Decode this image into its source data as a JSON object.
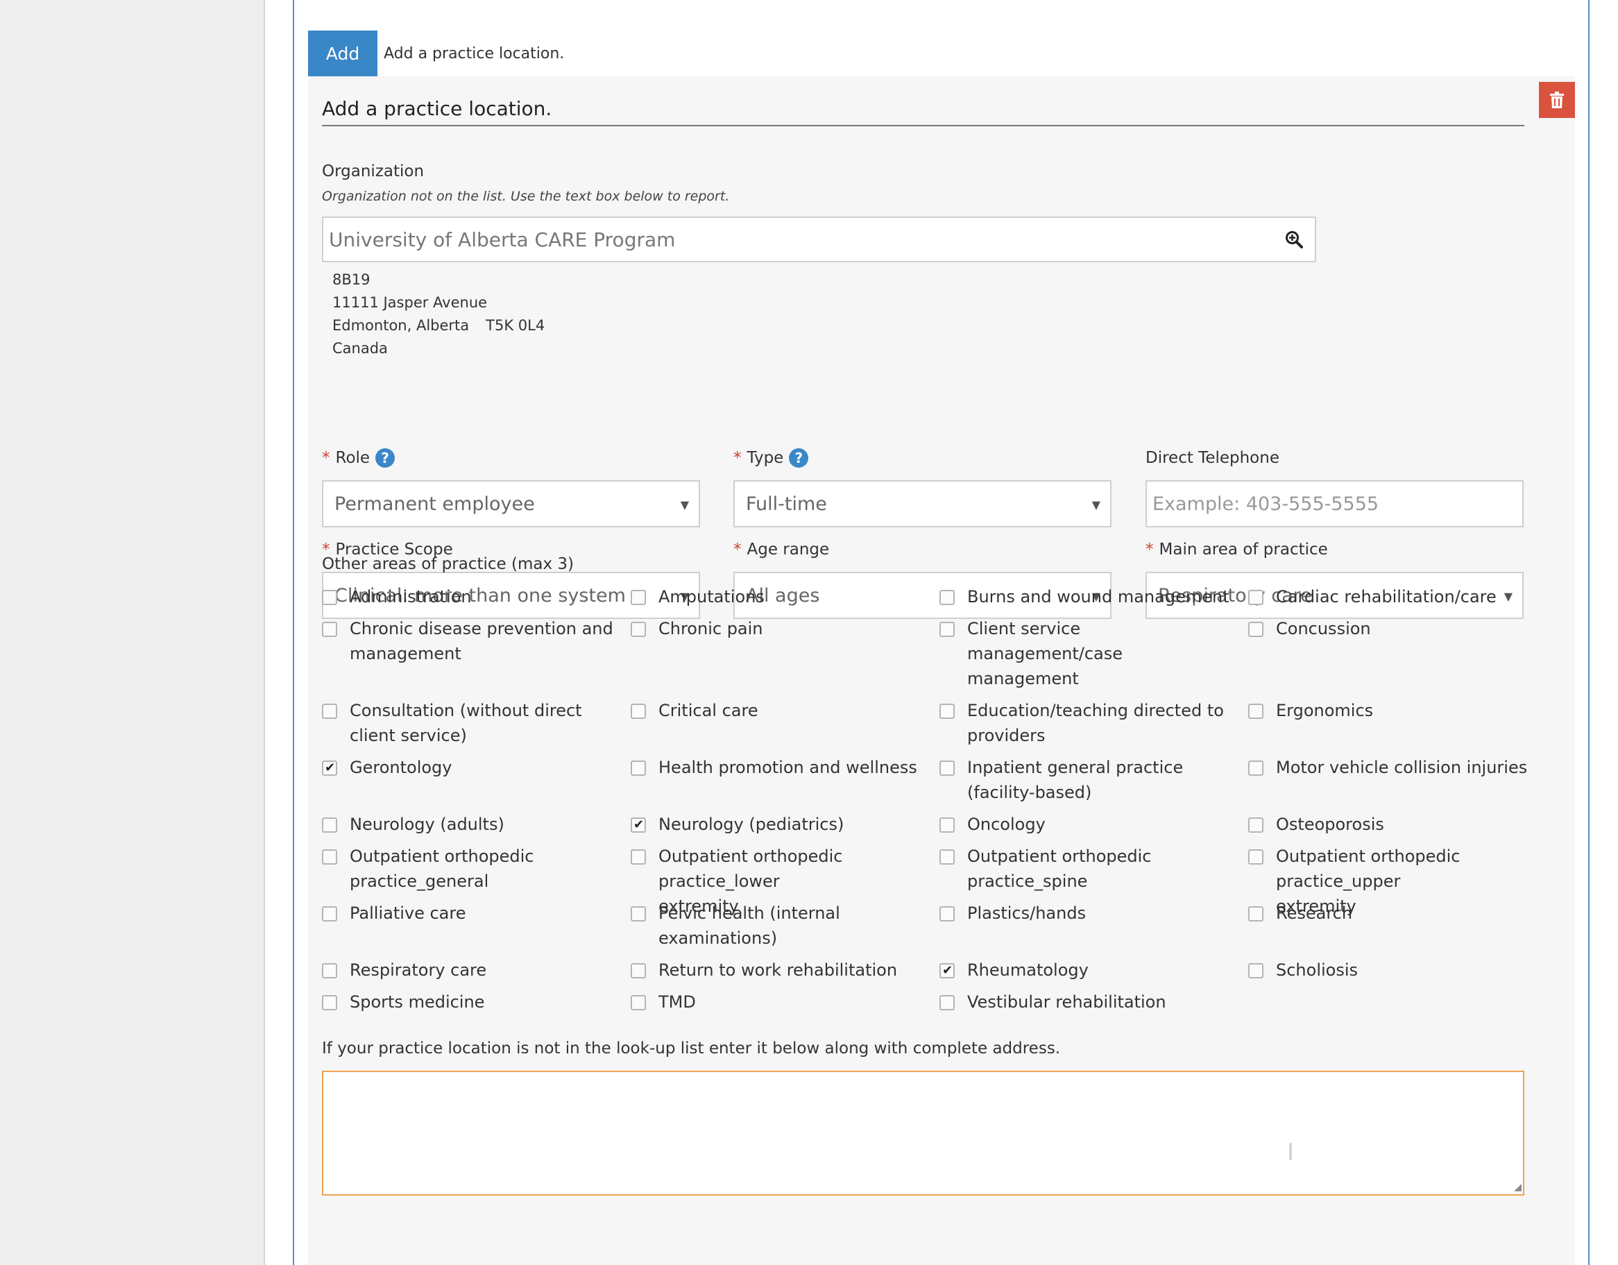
{
  "add_row": {
    "button_label": "Add",
    "hint": "Add a practice location."
  },
  "card": {
    "title": "Add a practice location.",
    "organization": {
      "label": "Organization",
      "note": "Organization not on the list. Use the text box below to report.",
      "value": "University of Alberta CARE Program",
      "address": {
        "line1": "8B19",
        "line2": "11111 Jasper Avenue",
        "city": "Edmonton, Alberta",
        "postal": "T5K 0L4",
        "country": "Canada"
      }
    },
    "fields": {
      "role": {
        "required_mark": "*",
        "label": "Role",
        "help": "?",
        "value": "Permanent employee"
      },
      "type": {
        "required_mark": "*",
        "label": "Type",
        "help": "?",
        "value": "Full-time"
      },
      "phone": {
        "label": "Direct Telephone",
        "placeholder": "Example: 403-555-5555"
      },
      "scope": {
        "required_mark": "*",
        "label": "Practice Scope",
        "value": "Clinical: more than one system"
      },
      "age": {
        "required_mark": "*",
        "label": "Age range",
        "value": "All ages"
      },
      "main_area": {
        "required_mark": "*",
        "label": "Main area of practice",
        "value": "Respiratory care"
      }
    },
    "other_areas": {
      "label": "Other areas of practice (max 3)",
      "items": [
        {
          "label": "Administration",
          "checked": false
        },
        {
          "label": "Amputations",
          "checked": false
        },
        {
          "label": "Burns and wound management",
          "checked": false
        },
        {
          "label": "Cardiac rehabilitation/care",
          "checked": false
        },
        {
          "label": "Chronic disease prevention and management",
          "checked": false
        },
        {
          "label": "Chronic pain",
          "checked": false
        },
        {
          "label": "Client service management/case management",
          "checked": false
        },
        {
          "label": "Concussion",
          "checked": false
        },
        {
          "label": "Consultation (without direct client service)",
          "checked": false
        },
        {
          "label": "Critical care",
          "checked": false
        },
        {
          "label": "Education/teaching directed to providers",
          "checked": false
        },
        {
          "label": "Ergonomics",
          "checked": false
        },
        {
          "label": "Gerontology",
          "checked": true
        },
        {
          "label": "Health promotion and wellness",
          "checked": false
        },
        {
          "label": "Inpatient general practice (facility-based)",
          "checked": false
        },
        {
          "label": "Motor vehicle collision injuries",
          "checked": false
        },
        {
          "label": "Neurology (adults)",
          "checked": false
        },
        {
          "label": "Neurology (pediatrics)",
          "checked": true
        },
        {
          "label": "Oncology",
          "checked": false
        },
        {
          "label": "Osteoporosis",
          "checked": false
        },
        {
          "label": "Outpatient orthopedic practice_general",
          "checked": false
        },
        {
          "label": "Outpatient orthopedic practice_lower extremity",
          "checked": false
        },
        {
          "label": "Outpatient orthopedic practice_spine",
          "checked": false
        },
        {
          "label": "Outpatient orthopedic practice_upper extremity",
          "checked": false
        },
        {
          "label": "Palliative care",
          "checked": false
        },
        {
          "label": "Pelvic health (internal examinations)",
          "checked": false
        },
        {
          "label": "Plastics/hands",
          "checked": false
        },
        {
          "label": "Research",
          "checked": false
        },
        {
          "label": "Respiratory care",
          "checked": false
        },
        {
          "label": "Return to work rehabilitation",
          "checked": false
        },
        {
          "label": "Rheumatology",
          "checked": true
        },
        {
          "label": "Scholiosis",
          "checked": false
        },
        {
          "label": "Sports medicine",
          "checked": false
        },
        {
          "label": "TMD",
          "checked": false
        },
        {
          "label": "Vestibular rehabilitation",
          "checked": false
        }
      ]
    },
    "lookup": {
      "label": "If your practice location is not in the look-up list enter it below along with complete address.",
      "value": ""
    }
  },
  "icons": {
    "delete": "trash-icon",
    "org_search": "zoom-in-icon",
    "help": "question-circle-icon"
  }
}
